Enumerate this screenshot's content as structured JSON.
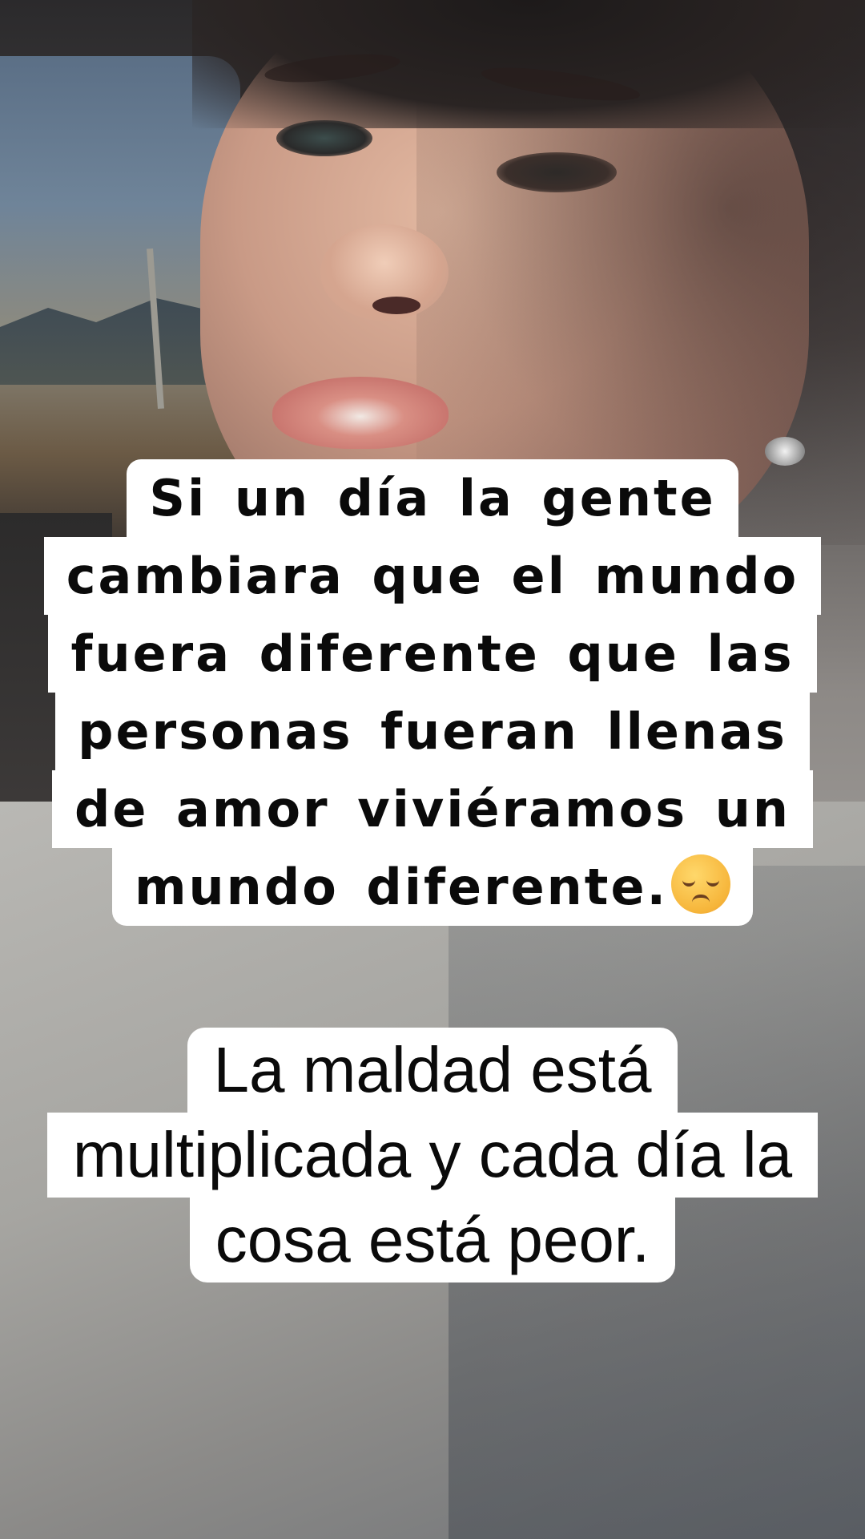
{
  "caption_top": {
    "lines": [
      "Si un día la gente",
      "cambiara que el mundo",
      "fuera diferente que las",
      "personas fueran  llenas",
      "de amor  viviéramos un",
      "mundo diferente."
    ],
    "emoji": "pensive-face-emoji"
  },
  "caption_bottom": {
    "lines": [
      "La maldad está",
      "multiplicada y cada día la",
      "cosa está peor."
    ]
  },
  "colors": {
    "caption_background": "#ffffff",
    "caption_text": "#0a0a0a"
  }
}
